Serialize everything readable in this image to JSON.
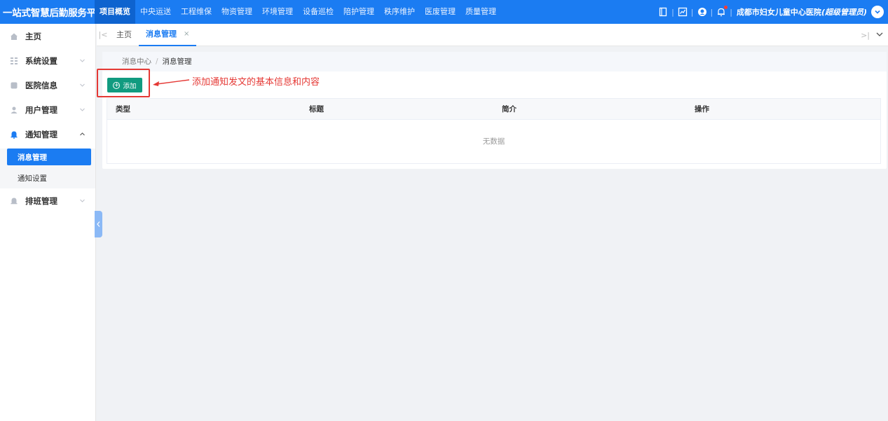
{
  "app": {
    "brand": "一站式智慧后勤服务平台",
    "nav": [
      "项目概览",
      "中央运送",
      "工程维保",
      "物资管理",
      "环境管理",
      "设备巡检",
      "陪护管理",
      "秩序维护",
      "医废管理",
      "质量管理"
    ],
    "nav_active_index": 0,
    "user": {
      "org": "成都市妇女儿童中心医院",
      "role": "(超级管理员)"
    },
    "accent_color": "#1b7cf2",
    "add_button_color": "#119b80"
  },
  "sidebar": {
    "items": [
      {
        "label": "主页",
        "icon": "home-icon"
      },
      {
        "label": "系统设置",
        "icon": "grid-icon"
      },
      {
        "label": "医院信息",
        "icon": "database-icon"
      },
      {
        "label": "用户管理",
        "icon": "user-icon"
      },
      {
        "label": "通知管理",
        "icon": "bell-icon"
      },
      {
        "label": "排班管理",
        "icon": "bell-icon"
      }
    ],
    "sub_items": [
      "消息管理",
      "通知设置"
    ]
  },
  "tabs": {
    "items": [
      "主页",
      "消息管理"
    ],
    "close_glyph": "×"
  },
  "main": {
    "breadcrumb": [
      "消息中心",
      "消息管理"
    ],
    "breadcrumb_sep": "/",
    "add_label": "添加",
    "annotation": "添加通知发文的基本信息和内容",
    "table": {
      "columns": [
        "类型",
        "标题",
        "简介",
        "操作"
      ],
      "empty_text": "无数据"
    }
  }
}
